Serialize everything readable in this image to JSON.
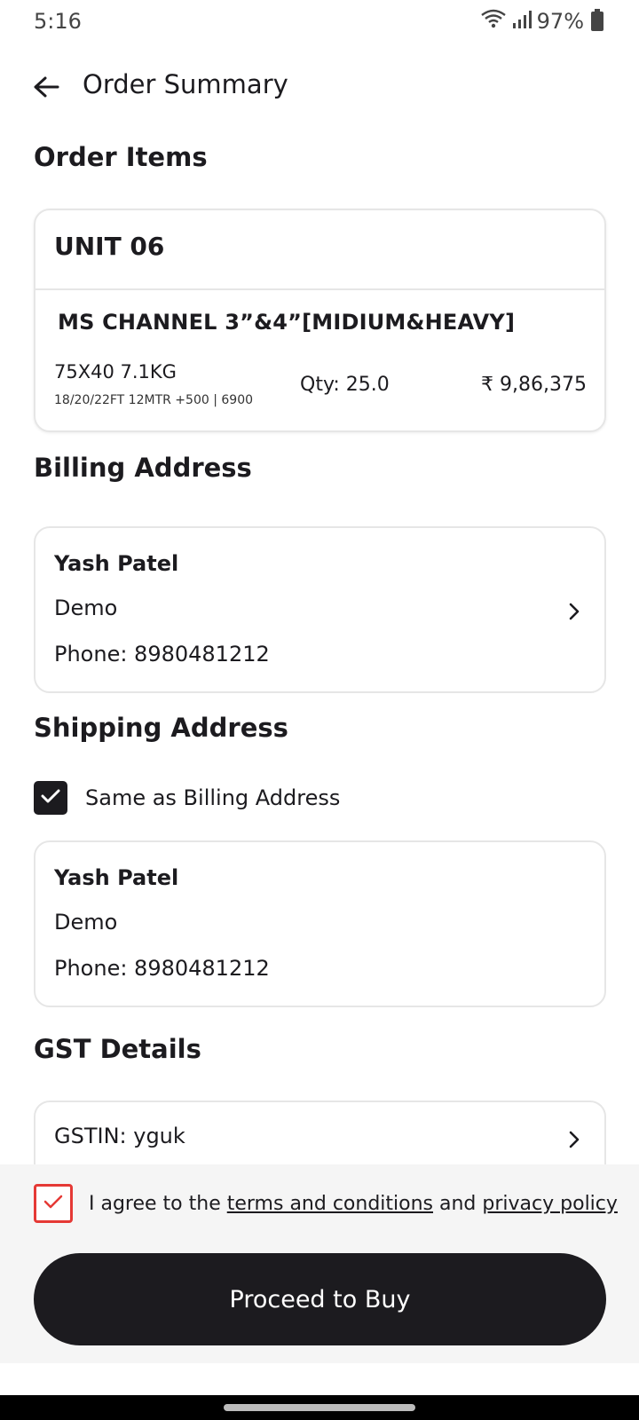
{
  "status_bar": {
    "time": "5:16",
    "battery": "97%"
  },
  "header": {
    "title": "Order Summary"
  },
  "order_items": {
    "section_title": "Order Items",
    "unit": "UNIT 06",
    "product": {
      "name": "MS CHANNEL 3”&4”[MIDIUM&HEAVY]",
      "size": "75X40 7.1KG",
      "spec": "18/20/22FT 12MTR +500 | 6900",
      "qty": "Qty: 25.0",
      "price": "₹ 9,86,375"
    }
  },
  "billing": {
    "section_title": "Billing Address",
    "name": "Yash Patel",
    "line": "Demo",
    "phone": "Phone: 8980481212"
  },
  "shipping": {
    "section_title": "Shipping Address",
    "same_as_billing_label": "Same as Billing Address",
    "same_as_billing_checked": true,
    "name": "Yash Patel",
    "line": "Demo",
    "phone": "Phone: 8980481212"
  },
  "gst": {
    "section_title": "GST Details",
    "gstin": "GSTIN: yguk"
  },
  "agreement": {
    "prefix": "I agree to the ",
    "terms_link": "terms and conditions",
    "middle": " and ",
    "privacy_link": "privacy policy",
    "checked": true,
    "highlight_color": "#e53935"
  },
  "proceed_button": {
    "label": "Proceed to Buy"
  }
}
